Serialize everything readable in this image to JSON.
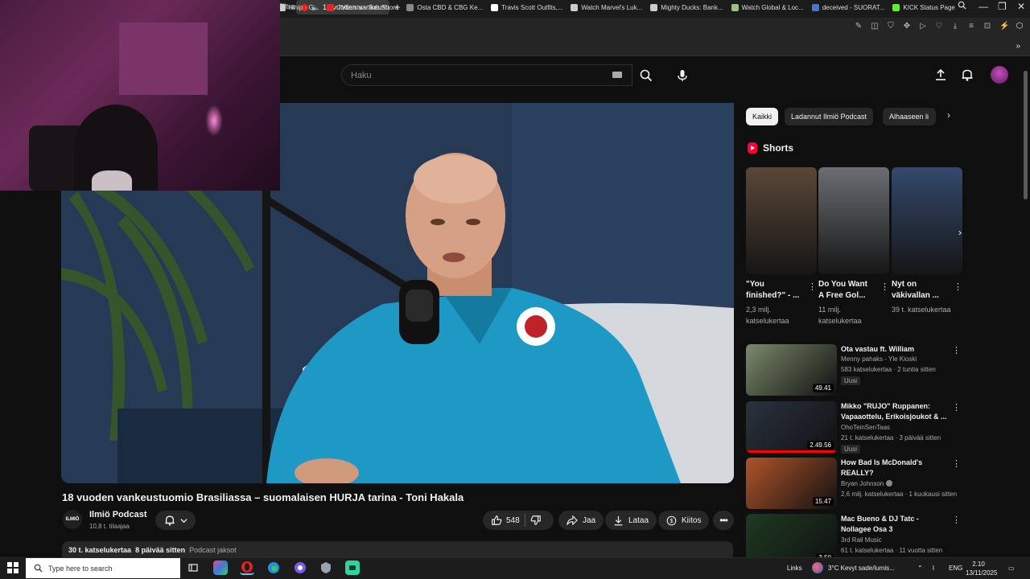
{
  "browser": {
    "tab_partial": "Filtra",
    "active_tab": "18 vuoden vankeustu",
    "new_tab": "+",
    "window_controls": [
      "—",
      "❐",
      "✕"
    ],
    "bookmarks": [
      {
        "label": "rship - G...",
        "icon": "bookmark-icon",
        "color": "#cccccc"
      },
      {
        "label": "TVkaista - Sub Suora",
        "icon": "tvkaista-icon",
        "color": "#e02828"
      },
      {
        "label": "Osta CBD & CBG Ke...",
        "icon": "cbd-icon",
        "color": "#888888"
      },
      {
        "label": "Travis Scott Outfits,...",
        "icon": "tshirt-icon",
        "color": "#ffffff"
      },
      {
        "label": "Watch Marvel's Luk...",
        "icon": "globe-icon",
        "color": "#cccccc"
      },
      {
        "label": "Mighty Ducks: Bank...",
        "icon": "duck-icon",
        "color": "#cccccc"
      },
      {
        "label": "Watch Global & Loc...",
        "icon": "world-icon",
        "color": "#9ec27a"
      },
      {
        "label": "deceived - SUORAT...",
        "icon": "suorat-icon",
        "color": "#3b7bd6"
      },
      {
        "label": "KICK Status Page",
        "icon": "kick-icon",
        "color": "#53fc18"
      }
    ]
  },
  "header": {
    "search_placeholder": "Haku"
  },
  "video": {
    "title": "18 vuoden vankeustuomio Brasiliassa – suomalaisen HURJA tarina - Toni Hakala",
    "channel": "Ilmiö Podcast",
    "channel_avatar_text": "ILMIÖ",
    "subscribers": "10,8 t. tilaajaa",
    "likes": "548",
    "share_label": "Jaa",
    "download_label": "Lataa",
    "thanks_label": "Kiitos",
    "views": "30 t. katselukertaa",
    "age": "8 päivää sitten",
    "tag": "Podcast jaksot"
  },
  "chips": [
    {
      "label": "Kaikki",
      "active": true
    },
    {
      "label": "Ladannut Ilmiö Podcast",
      "active": false
    },
    {
      "label": "Alhaaseen li",
      "active": false
    }
  ],
  "shorts": {
    "heading": "Shorts",
    "items": [
      {
        "title": "\"You finished?\" - ...",
        "views": "2,3 milj. katselukertaa",
        "bg": "#5a4638"
      },
      {
        "title": "Do You Want A Free Gol...",
        "views": "11 milj. katselukertaa",
        "bg": "#6b6e72"
      },
      {
        "title": "Nyt on väkivallan ...",
        "views": "39 t. katselukertaa",
        "bg": "#34496d"
      }
    ]
  },
  "recommendations": [
    {
      "title": "Ota vastau ft. William",
      "channel": "Menny pahaks - Yle Kioski",
      "meta": "583 katselukertaa · 2 tuntia sitten",
      "badge": "Uusi",
      "duration": "49.41",
      "verified": false,
      "thumb": "#7a8a6a",
      "progress": 0
    },
    {
      "title": "Mikko \"RUJO\" Ruppanen: Vapaaottelu, Erikoisjoukot & ...",
      "channel": "OhoTeinSenTaas",
      "meta": "21 t. katselukertaa · 3 päivää sitten",
      "badge": "Uusi",
      "duration": "2.49.56",
      "verified": false,
      "thumb": "#2a3340",
      "progress": 1
    },
    {
      "title": "How Bad Is McDonald's REALLY?",
      "channel": "Bryan Johnson",
      "meta": "2,6 milj. katselukertaa · 1 kuukausi sitten",
      "badge": "",
      "duration": "15.47",
      "verified": true,
      "thumb": "#b0542a",
      "progress": 0
    },
    {
      "title": "Mac Bueno & DJ Tatc - Nollagee Osa 3",
      "channel": "3rd Rail Music",
      "meta": "61 t. katselukertaa · 11 vuotta sitten",
      "badge": "",
      "duration": "3.50",
      "verified": false,
      "thumb": "#1e3a22",
      "progress": 0
    }
  ],
  "taskbar": {
    "search_placeholder": "Type here to search",
    "links_label": "Links",
    "weather": "3°C  Kevyt sade/lumis...",
    "lang": "ENG",
    "time": "2.10",
    "date": "13/11/2025"
  }
}
